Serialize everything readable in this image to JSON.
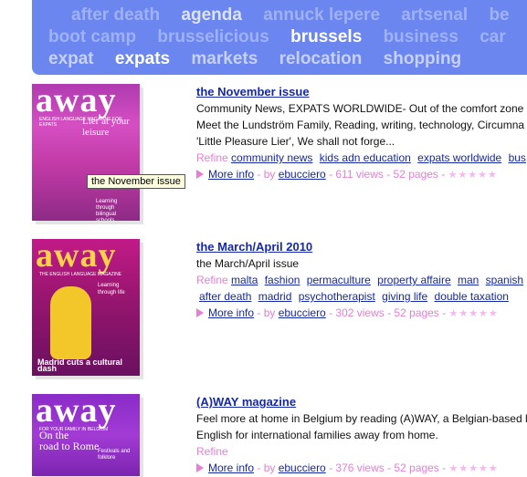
{
  "tagcloud": {
    "rows": [
      [
        {
          "t": "after death",
          "hi": false,
          "faint": true
        },
        {
          "t": "agenda",
          "hi": false
        },
        {
          "t": "annuck lepere",
          "hi": false,
          "faint": true
        },
        {
          "t": "artsenal",
          "hi": false
        },
        {
          "t": "be",
          "hi": false
        }
      ],
      [
        {
          "t": "boot camp",
          "hi": false
        },
        {
          "t": "brusselicious",
          "hi": false
        },
        {
          "t": "brussels",
          "hi": true
        },
        {
          "t": "business",
          "hi": false
        },
        {
          "t": "car",
          "hi": false
        }
      ],
      [
        {
          "t": "expat",
          "hi": false
        },
        {
          "t": "expats",
          "hi": true
        },
        {
          "t": "markets",
          "hi": false
        },
        {
          "t": "relocation",
          "hi": false
        },
        {
          "t": "shopping",
          "hi": false
        }
      ]
    ]
  },
  "tooltip": "the November issue",
  "pubs": [
    {
      "title": "the November issue",
      "desc": [
        "Community News, EXPATS WORLDWIDE- Out of the comfort zone I",
        "Meet the Lundström Family, Reading, writing, technology, Circumna",
        "'Little Pleasure Lier', We shall not forge..."
      ],
      "refine_label": "Refine",
      "tags_rows": [
        [
          "community news",
          "kids adn education",
          "expats worldwide",
          "bus"
        ]
      ],
      "more_info": "More info",
      "by": " - by ",
      "author": "ebucciero",
      "stats": " - 611 views - 52 pages - ",
      "stars": "★★★★★",
      "cover": {
        "brand": "away",
        "strap": "ENGLISH LANGUAGE MAGAZINE FOR EXPATS",
        "line1": "Lier at your",
        "line2": "leisure",
        "small": "Learning through bilingual schools"
      }
    },
    {
      "title": "the March/April 2010",
      "desc": [
        "the March/April issue"
      ],
      "refine_label": "Refine",
      "tags_rows": [
        [
          "malta",
          "fashion",
          "permaculture",
          "property affaire",
          "man",
          "spanish"
        ],
        [
          "after death",
          "madrid",
          "psychotherapist",
          "giving life",
          "double taxation"
        ]
      ],
      "more_info": "More info",
      "by": " - by ",
      "author": "ebucciero",
      "stats": " - 302 views - 52 pages - ",
      "stars": "★★★★★",
      "cover": {
        "brand": "away",
        "strap": "THE ENGLISH LANGUAGE MAGAZINE",
        "line1": "Learning",
        "line2": "through life",
        "small": "Madrid cuts a cultural dash"
      }
    },
    {
      "title": "(A)WAY magazine",
      "desc": [
        "Feel more at home in Belgium by reading (A)WAY, a Belgian-based li",
        "English for international families away from home."
      ],
      "refine_label": "Refine",
      "tags_rows": [],
      "more_info": "More info",
      "by": " - by ",
      "author": "ebucciero",
      "stats": " - 376 views - 52 pages - ",
      "stars": "★★★★★",
      "cover": {
        "brand": "away",
        "strap": "FOR YOUR FAMILY IN BELGIUM",
        "line1": "On the",
        "line2": "road to Rome",
        "small": "Festivals and folklore"
      }
    }
  ]
}
